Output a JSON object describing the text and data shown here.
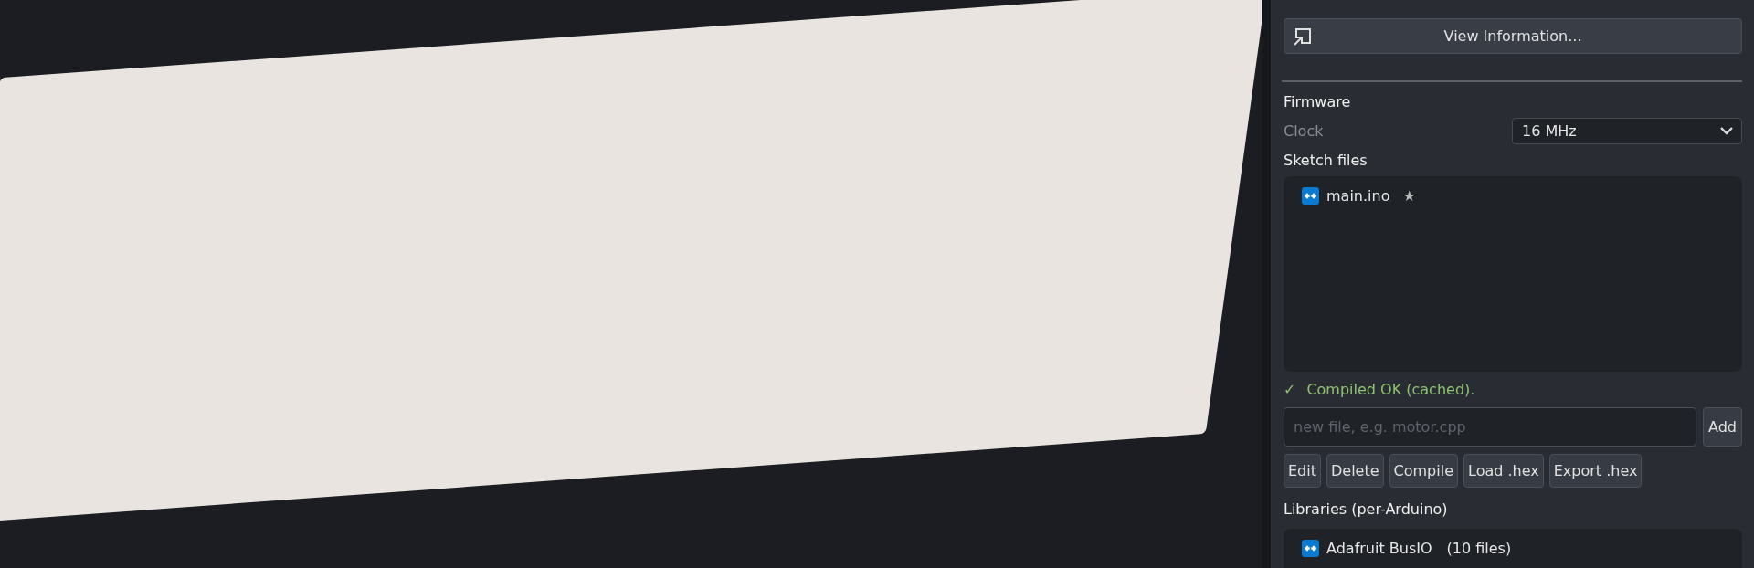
{
  "panel": {
    "view_button": "View Information...",
    "firmware": {
      "heading": "Firmware",
      "clock_label": "Clock",
      "clock_value": "16 MHz"
    },
    "sketch": {
      "heading": "Sketch files",
      "files": [
        {
          "name": "main.ino",
          "star": "★"
        }
      ]
    },
    "status": {
      "icon": "✓",
      "text": "Compiled OK (cached)."
    },
    "new_file": {
      "placeholder": "new file, e.g. motor.cpp",
      "add_button": "Add"
    },
    "actions": [
      "Edit",
      "Delete",
      "Compile",
      "Load .hex",
      "Export .hex"
    ],
    "libraries": {
      "heading": "Libraries (per-Arduino)",
      "items": [
        {
          "name": "Adafruit BusIO",
          "count": "(10 files)"
        }
      ]
    }
  }
}
